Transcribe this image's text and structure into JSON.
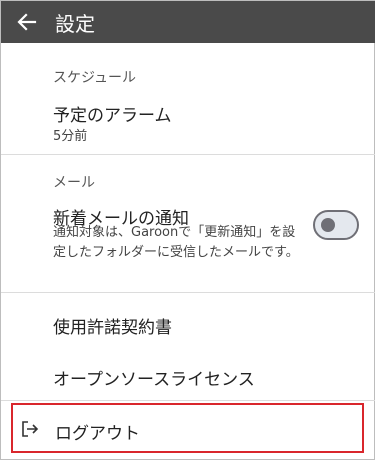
{
  "appbar": {
    "title": "設定",
    "back_icon": "arrow-back-icon"
  },
  "schedule": {
    "header": "スケジュール",
    "alarm_title": "予定のアラーム",
    "alarm_value": "5分前"
  },
  "mail": {
    "header": "メール",
    "notify_title": "新着メールの通知",
    "notify_desc": "通知対象は、Garoonで「更新通知」を設定したフォルダーに受信したメールです。",
    "notify_enabled": false
  },
  "links": {
    "license_agreement": "使用許諾契約書",
    "open_source": "オープンソースライセンス"
  },
  "logout": {
    "label": "ログアウト",
    "icon": "logout-icon"
  },
  "colors": {
    "appbar": "#4a4a4a",
    "highlight_border": "#d9262c",
    "toggle_off": "#6f6f76"
  }
}
